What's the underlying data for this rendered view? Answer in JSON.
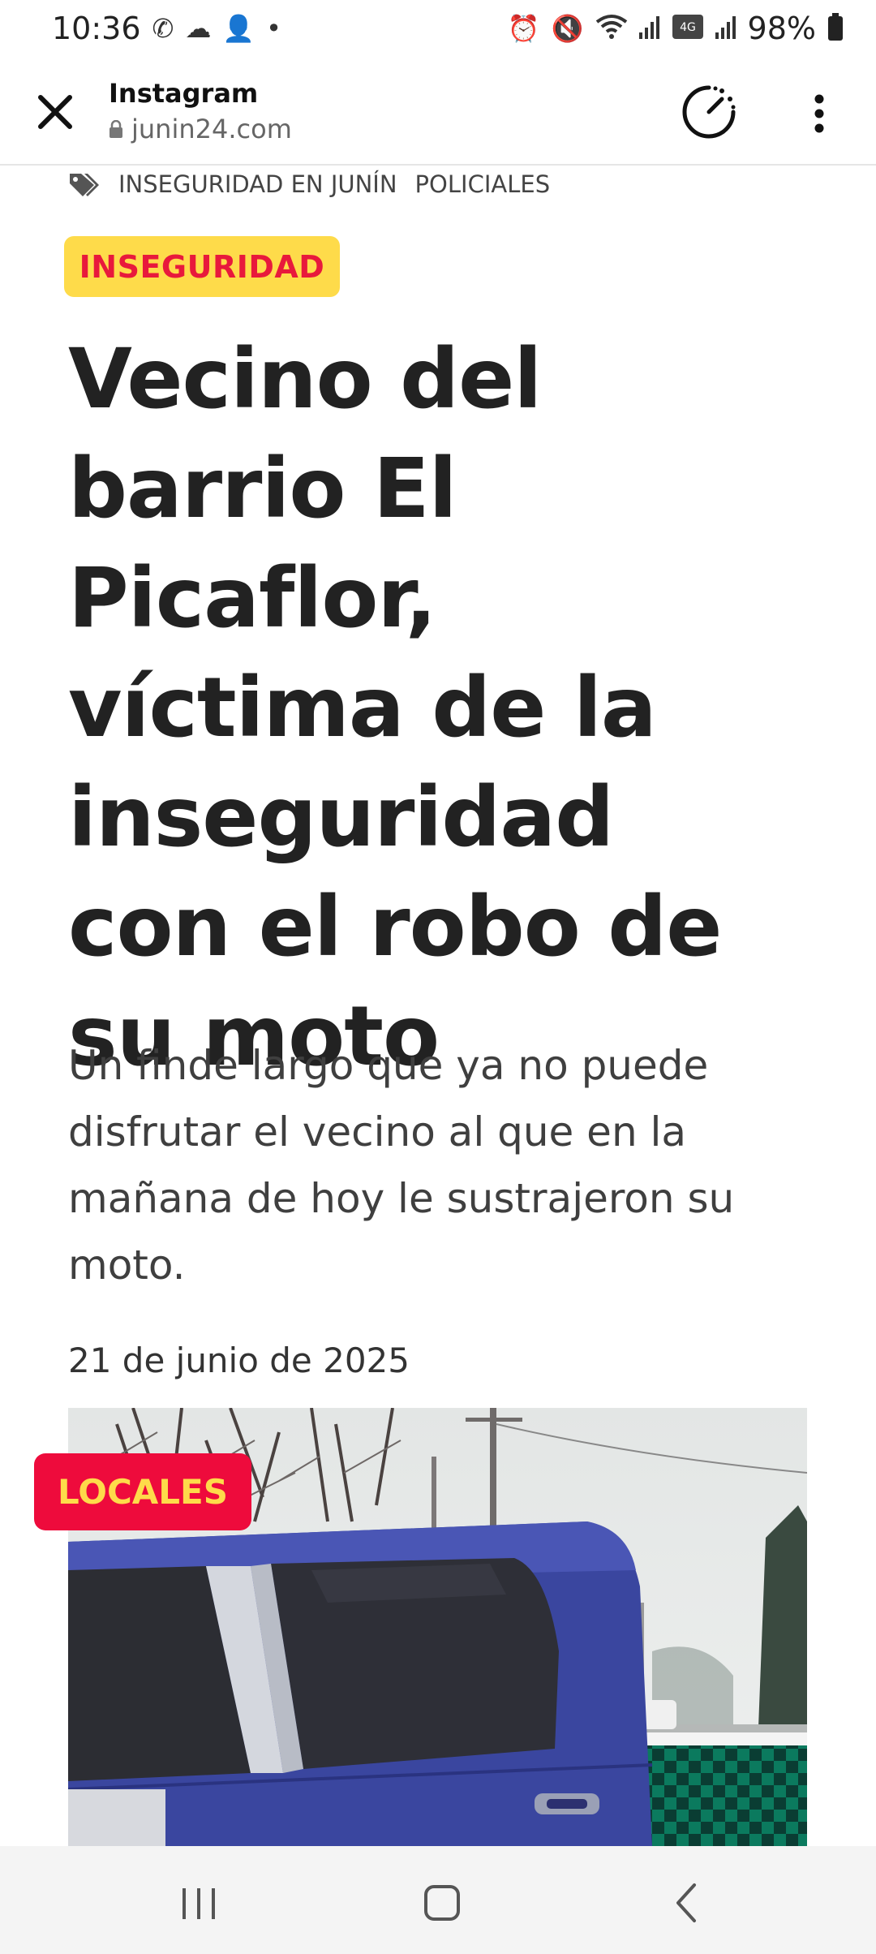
{
  "status_bar": {
    "time": "10:36",
    "battery": "98%",
    "icons_left": [
      "whatsapp-icon",
      "cloud-icon",
      "add-user-icon",
      "dot-icon"
    ],
    "icons_right": [
      "alarm-icon",
      "mute-icon",
      "wifi-icon",
      "signal-icon",
      "volte-icon",
      "signal-icon",
      "battery-icon"
    ]
  },
  "browser": {
    "title": "Instagram",
    "url": "junin24.com"
  },
  "article": {
    "tags": [
      "INSEGURIDAD EN JUNÍN",
      "POLICIALES"
    ],
    "category": "INSEGURIDAD",
    "headline": "Vecino del barrio El Picaflor, víctima de la inseguridad con el robo de su moto",
    "subtitle": "Un finde largo que ya no puede disfrutar el vecino al que en la mañana de hoy le sustrajeron su moto.",
    "date": "21 de junio de 2025",
    "image_badge": "LOCALES"
  },
  "colors": {
    "pill_bg": "#fedb4a",
    "pill_text": "#e8193c",
    "badge_bg": "#ee0b3c",
    "badge_text": "#fedb4a"
  }
}
